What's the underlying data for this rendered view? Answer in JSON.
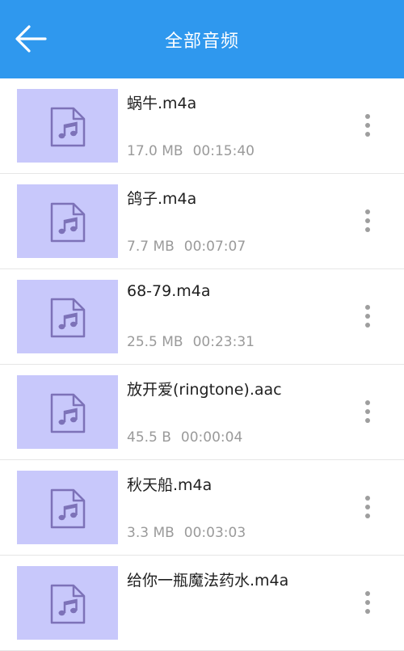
{
  "header": {
    "title": "全部音频",
    "back_icon": "back-arrow-icon",
    "background": "#2f98ee"
  },
  "files": [
    {
      "name": "蜗牛.m4a",
      "size": "17.0 MB",
      "duration": "00:15:40",
      "icon": "audio-file-icon"
    },
    {
      "name": "鸽子.m4a",
      "size": "7.7 MB",
      "duration": "00:07:07",
      "icon": "audio-file-icon"
    },
    {
      "name": "68-79.m4a",
      "size": "25.5 MB",
      "duration": "00:23:31",
      "icon": "audio-file-icon"
    },
    {
      "name": "放开爱(ringtone).aac",
      "size": "45.5 B",
      "duration": "00:00:04",
      "icon": "audio-file-icon"
    },
    {
      "name": "秋天船.m4a",
      "size": "3.3 MB",
      "duration": "00:03:03",
      "icon": "audio-file-icon"
    },
    {
      "name": "给你一瓶魔法药水.m4a",
      "size": "",
      "duration": "",
      "icon": "audio-file-icon"
    }
  ],
  "colors": {
    "thumb_bg": "#c8c8fb",
    "thumb_icon": "#7d72b8",
    "meta_text": "#9a9a9a"
  }
}
